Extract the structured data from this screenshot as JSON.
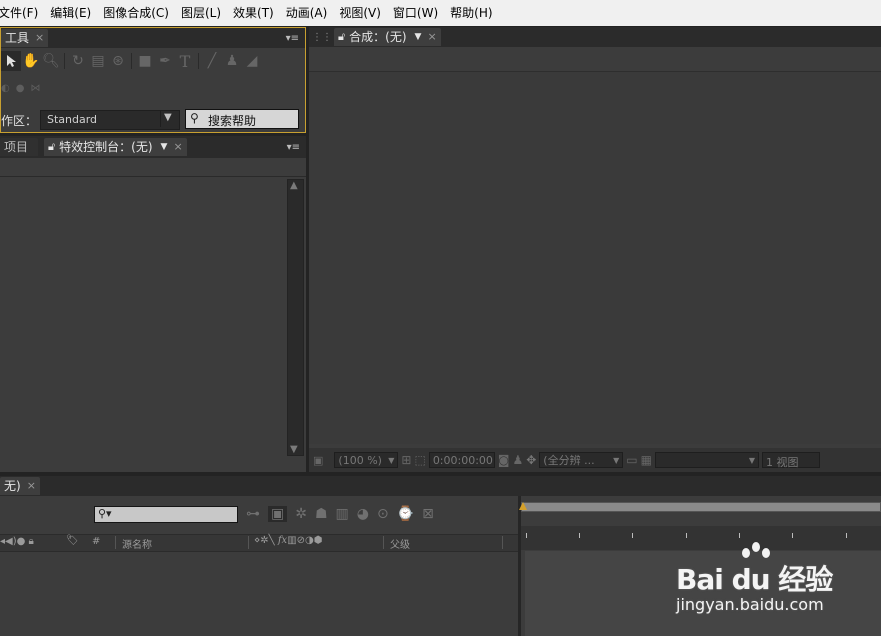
{
  "menubar": {
    "items": [
      "文件(F)",
      "编辑(E)",
      "图像合成(C)",
      "图层(L)",
      "效果(T)",
      "动画(A)",
      "视图(V)",
      "窗口(W)",
      "帮助(H)"
    ]
  },
  "tools_panel": {
    "tab_label": "工具",
    "workspace_label": "作区：",
    "workspace_value": "Standard",
    "search_help_label": "搜索帮助"
  },
  "project_panel": {
    "tab_project": "项目",
    "tab_effects": "特效控制台：(无)"
  },
  "composition_panel": {
    "tab_label": "合成：(无)",
    "zoom": "(100 %)",
    "timecode": "0:00:00:00",
    "resolution": "(全分辨 ...",
    "view_count": "1 视图"
  },
  "timeline_panel": {
    "tab_label": "无)",
    "col_hash": "#",
    "col_source_name": "源名称",
    "col_parent": "父级"
  },
  "watermark": {
    "brand": "Bai du 经验",
    "url": "jingyan.baidu.com"
  },
  "colors": {
    "accent_outline": "#c8a030",
    "panel_bg": "#3c3c3c",
    "frame_bg": "#232323"
  }
}
